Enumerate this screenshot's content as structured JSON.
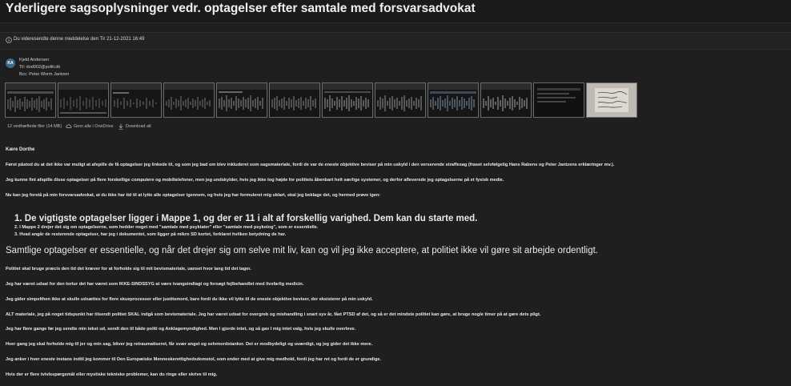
{
  "subject": "Yderligere sagsoplysninger vedr. optagelser efter samtale med forsvarsadvokat",
  "forwarded_notice": "Du videresendte denne meddelelse den Tir 21-12-2021 16:49",
  "sender": {
    "initials": "KA",
    "name": "Kjeld Andersen",
    "to": "Til: dod002@politi.dk",
    "bcc": "Bcc: Peter Worm Jantzen"
  },
  "attachments": {
    "count_label": "12 vedhæftede filer (14 MB)",
    "save_onedrive": "Gem alle i OneDrive",
    "download_all": "Download alt"
  },
  "body": {
    "greeting": "Kære Dorthe",
    "p1": "Først påstod du at det ikke var muligt at afspille de få optagelser jeg linkede til, og som jeg bad om blev inkluderet som sagsmateriale, fordi de var de eneste objektive beviser på min uskyld i den verserende straffesag (fraset selvfølgelig Hans Rabens og Peter Jantzens erklæringer mv.).",
    "p2": "Jeg kunne fint afspille disse optagelser på flere forskellige computere og mobiltelefoner, men jeg undskylder, hvis jeg ikke tog højde for politiets åbenbart helt særlige systemer, og derfor afleverede jeg optagelserne på et fysisk medie.",
    "p3": "Nu kan jeg forstå på min forsvarsadvokat, at du ikke har tid til at lytte alle optagelser igennem, og hvis jeg har formuleret mig uklart, skal jeg beklage det, og hermed prøve igen:",
    "list": [
      "De vigtigste optagelser ligger i Mappe 1, og der er 11 i alt af forskellig varighed. Dem kan du starte med.",
      "I Mappe 2 drejer det sig om optagelserne, som hedder noget med \"samtale med psykiater\" eller \"samtale med psykolog\", som er essentielle.",
      "Hvad angår de resterende optagelser, har jeg i dokumentet, som ligger på mikro SD kortet, forklaret hvilken betydning de har."
    ],
    "emphasis": "Samtlige optagelser er essentielle, og når det drejer sig om selve mit liv, kan og vil jeg ikke acceptere, at politiet ikke vil gøre sit arbejde ordentligt.",
    "p4": "Politiet skal bruge præcis den tid det kræver for at forholde sig til mit bevismateriale, uanset hvor lang tid det tager.",
    "p5": "Jeg har været udsat for den tortur det har været som IKKE-SINDSSYG at være tvangsindlagt og forsøgt fejlbehandlet med livsfarlig medicin.",
    "p6": "Jeg gider simpelthen ikke at skulle udsættes for flere skueprocesser eller justitsmord, bare fordi du ikke vil lytte til de eneste objektive beviser, der eksisterer på min uskyld.",
    "p7": "ALT materiale, jeg på noget tidspunkt har tilsendt politiet SKAL indgå som bevismateriale. Jeg har været udsat for overgreb og mishandling i snart syv år, fået PTSD af det, og så er det mindste politiet kan gøre, at bruge nogle timer på at gøre dets pligt.",
    "p8": "Jeg har flere gange før jeg sendte min tekst ud, sendt den til både politi og Anklagemyndighed. Men I gjorde intet, og så gav I mig intet valg, hvis jeg skulle overleve.",
    "p9": "Hver gang jeg skal forholde mig til jer og min sag, bliver jeg retraumatiseret, får svær angst og selvmordstanker. Det er modbydeligt og uværdigt, og jeg gider det ikke mere.",
    "p10": "Jeg anker i hver eneste instans indtil jeg kommer til Den Europæiske Menneskerettighedsdomstol, som ender med at give mig medhold, fordi jeg har ret og fordi de er grundige.",
    "p11": "Hvis der er flere tvivlsspørgsmål eller mystiske tekniske problemer, kan du ringe eller skrive til mig."
  }
}
